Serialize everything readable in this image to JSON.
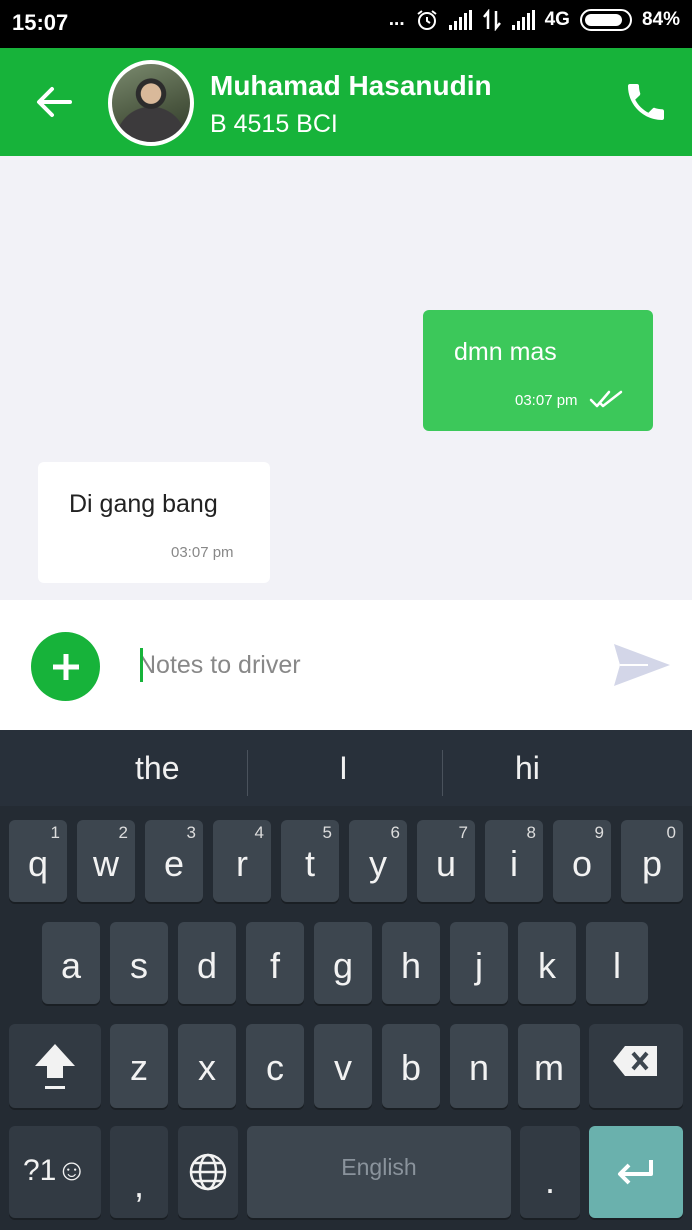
{
  "status_bar": {
    "time": "15:07",
    "dots": "...",
    "network": "4G",
    "battery": "84%"
  },
  "header": {
    "name": "Muhamad Hasanudin",
    "plate": "B 4515 BCI"
  },
  "messages": [
    {
      "direction": "out",
      "text": "dmn mas",
      "time": "03:07 pm"
    },
    {
      "direction": "in",
      "text": "Di gang bang",
      "time": "03:07 pm"
    }
  ],
  "input": {
    "placeholder": "Notes to driver",
    "value": ""
  },
  "colors": {
    "brand_green": "#17b33a",
    "bubble_green": "#3cc85a",
    "chat_bg": "#f2f2f7",
    "keyboard_bg": "#242b33",
    "enter_key": "#6ab1ad"
  },
  "keyboard": {
    "suggestions": [
      "the",
      "I",
      "hi"
    ],
    "row1": [
      {
        "key": "q",
        "hint": "1"
      },
      {
        "key": "w",
        "hint": "2"
      },
      {
        "key": "e",
        "hint": "3"
      },
      {
        "key": "r",
        "hint": "4"
      },
      {
        "key": "t",
        "hint": "5"
      },
      {
        "key": "y",
        "hint": "6"
      },
      {
        "key": "u",
        "hint": "7"
      },
      {
        "key": "i",
        "hint": "8"
      },
      {
        "key": "o",
        "hint": "9"
      },
      {
        "key": "p",
        "hint": "0"
      }
    ],
    "row2": [
      "a",
      "s",
      "d",
      "f",
      "g",
      "h",
      "j",
      "k",
      "l"
    ],
    "row3": [
      "z",
      "x",
      "c",
      "v",
      "b",
      "n",
      "m"
    ],
    "symbols_label": "?1☺",
    "comma": ",",
    "space_label": "English",
    "period": "."
  }
}
